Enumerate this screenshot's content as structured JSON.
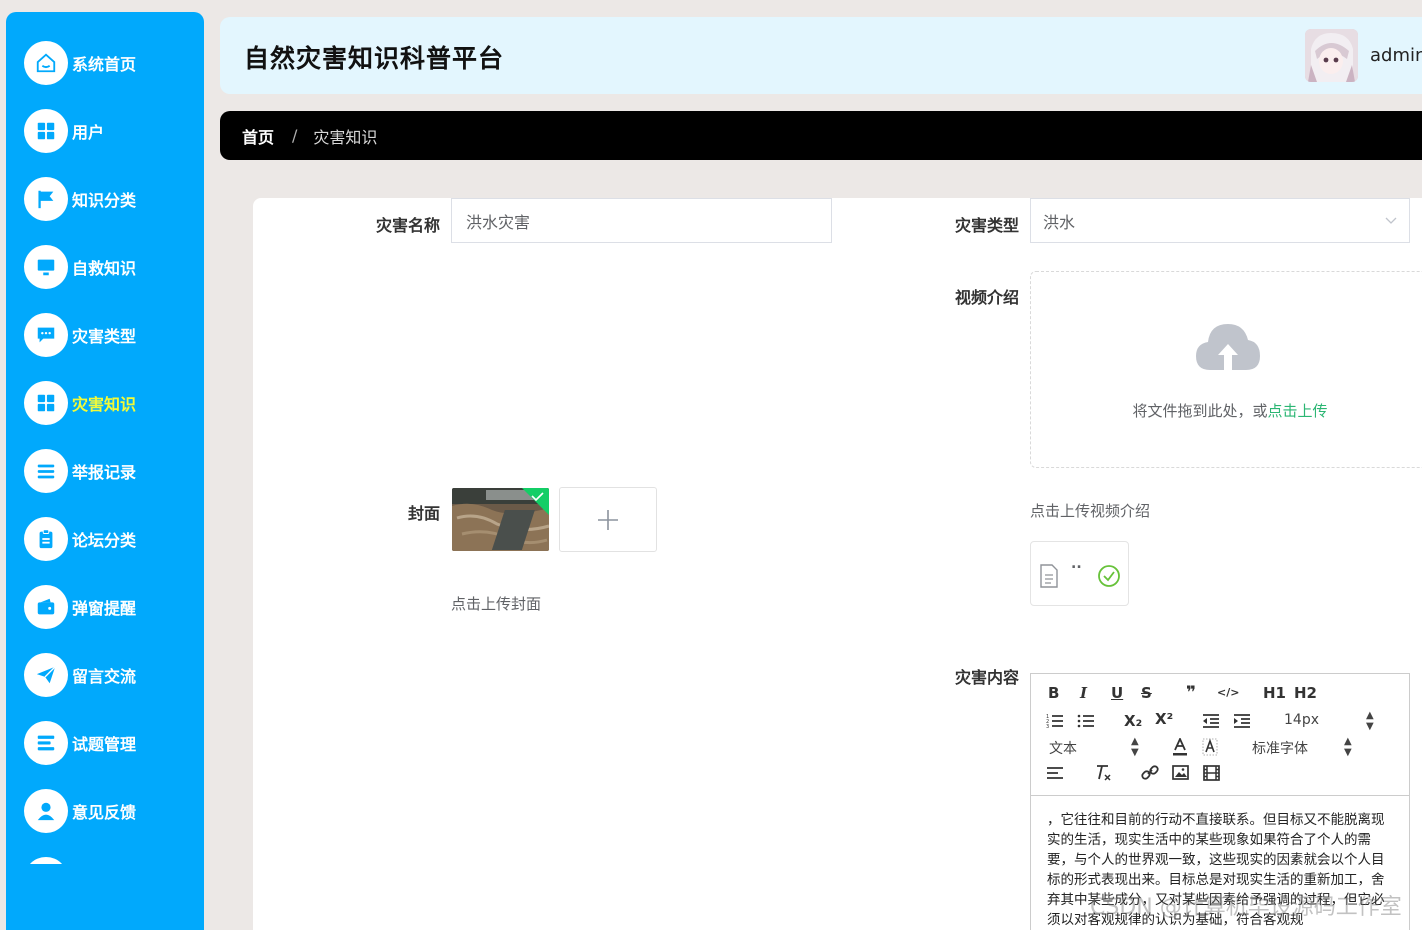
{
  "sidebar": {
    "items": [
      {
        "label": "系统首页",
        "icon": "home-icon"
      },
      {
        "label": "用户",
        "icon": "grid-icon"
      },
      {
        "label": "知识分类",
        "icon": "flag-icon"
      },
      {
        "label": "自救知识",
        "icon": "monitor-icon"
      },
      {
        "label": "灾害类型",
        "icon": "chat-icon"
      },
      {
        "label": "灾害知识",
        "icon": "grid-icon",
        "active": true
      },
      {
        "label": "举报记录",
        "icon": "list-icon"
      },
      {
        "label": "论坛分类",
        "icon": "clipboard-icon"
      },
      {
        "label": "弹窗提醒",
        "icon": "wallet-icon"
      },
      {
        "label": "留言交流",
        "icon": "send-icon"
      },
      {
        "label": "试题管理",
        "icon": "menu-icon"
      },
      {
        "label": "意见反馈",
        "icon": "user-icon"
      }
    ],
    "active_color": "#f3fb38",
    "background": "#01a9fc"
  },
  "header": {
    "title": "自然灾害知识科普平台",
    "username": "admin"
  },
  "breadcrumb": {
    "home": "首页",
    "separator": "/",
    "current": "灾害知识"
  },
  "form": {
    "name_label": "灾害名称",
    "name_value": "洪水灾害",
    "type_label": "灾害类型",
    "type_value": "洪水",
    "video_label": "视频介绍",
    "video_upload_text": "将文件拖到此处，或",
    "video_upload_link": "点击上传",
    "video_tip": "点击上传视频介绍",
    "video_file_name": "..",
    "cover_label": "封面",
    "cover_tip": "点击上传封面",
    "content_label": "灾害内容"
  },
  "editor": {
    "toolbar": {
      "bold": "B",
      "italic": "I",
      "underline": "U",
      "strike": "S",
      "quote": "❞",
      "code": "</>",
      "h1": "H1",
      "h2": "H2",
      "subscript": "X₂",
      "superscript": "X²",
      "font_size": "14px",
      "text_type": "文本",
      "font_family": "标准字体"
    },
    "content": "，它往往和目前的行动不直接联系。但目标又不能脱离现实的生活，现实生活中的某些现象如果符合了个人的需要，与个人的世界观一致，这些现实的因素就会以个人目标的形式表现出来。目标总是对现实生活的重新加工，舍弃其中某些成分，又对某些因素给予强调的过程，但它必须以对客观规律的认识为基础，符合客观规"
  },
  "watermark": "CSDN @计算机毕设源码工作室"
}
